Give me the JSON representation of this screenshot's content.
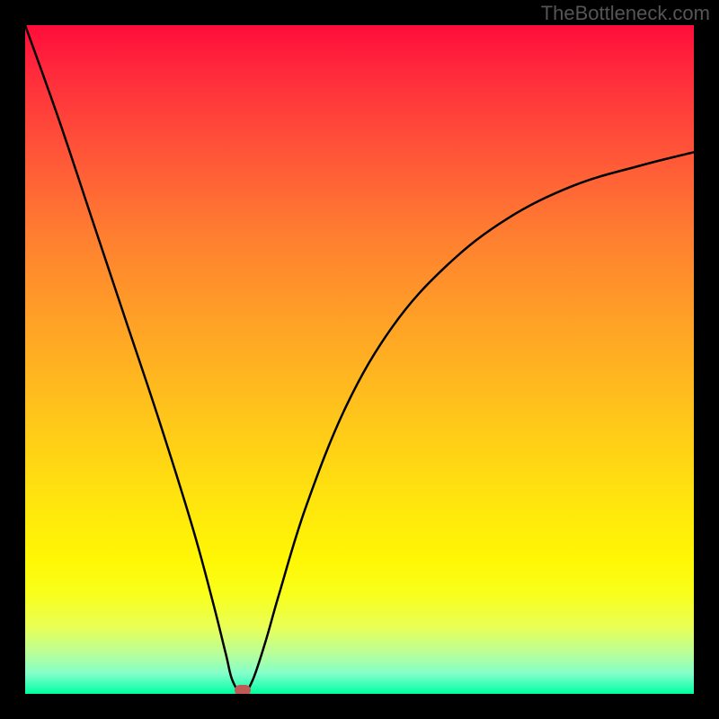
{
  "attribution": "TheBottleneck.com",
  "chart_data": {
    "type": "line",
    "title": "",
    "xlabel": "",
    "ylabel": "",
    "xlim": [
      0,
      100
    ],
    "ylim": [
      0,
      100
    ],
    "grid": false,
    "legend": false,
    "series": [
      {
        "name": "bottleneck-curve",
        "x": [
          0,
          5,
          10,
          15,
          20,
          25,
          28,
          30,
          31,
          32.5,
          34,
          36,
          38,
          42,
          48,
          55,
          63,
          72,
          82,
          92,
          100
        ],
        "y": [
          100,
          86,
          71,
          56,
          41,
          25,
          14,
          6,
          2,
          0,
          2,
          8,
          15,
          28,
          43,
          55,
          64,
          71,
          76,
          79,
          81
        ]
      }
    ],
    "marker": {
      "x": 32.5,
      "y": 0,
      "color": "#c05a56"
    },
    "background_gradient": {
      "stops": [
        {
          "pos": 0.0,
          "color": "#ff0d3a"
        },
        {
          "pos": 0.5,
          "color": "#ffb020"
        },
        {
          "pos": 0.8,
          "color": "#fff705"
        },
        {
          "pos": 1.0,
          "color": "#00ff98"
        }
      ]
    }
  }
}
